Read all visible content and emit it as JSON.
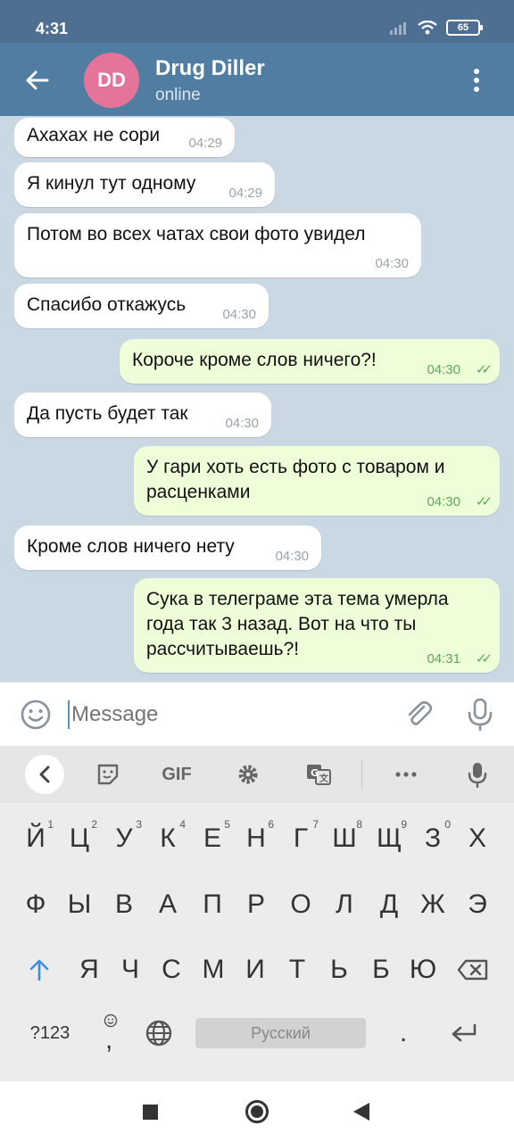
{
  "status_bar": {
    "time": "4:31",
    "battery": "65"
  },
  "header": {
    "avatar_initials": "DD",
    "name": "Drug Diller",
    "status": "online"
  },
  "messages": [
    {
      "text": "Ахахах не сори",
      "time": "04:29",
      "direction": "in"
    },
    {
      "text": "Я кинул тут одному",
      "time": "04:29",
      "direction": "in"
    },
    {
      "text": "Потом во всех чатах свои фото увидел",
      "time": "04:30",
      "direction": "in"
    },
    {
      "text": "Спасибо откажусь",
      "time": "04:30",
      "direction": "in"
    },
    {
      "text": "Короче кроме слов  ничего?!",
      "time": "04:30",
      "direction": "out",
      "read": true
    },
    {
      "text": "Да пусть будет так",
      "time": "04:30",
      "direction": "in"
    },
    {
      "text": "У гари хоть есть фото с товаром и расценками",
      "time": "04:30",
      "direction": "out",
      "read": true
    },
    {
      "text": "Кроме слов ничего нету",
      "time": "04:30",
      "direction": "in"
    },
    {
      "text": "Сука в телеграме эта тема умерла года так 3 назад.  Вот на что ты рассчитываешь?!",
      "time": "04:31",
      "direction": "out",
      "read": true
    }
  ],
  "composer": {
    "placeholder": "Message"
  },
  "keyboard": {
    "toolbar": {
      "gif_label": "GIF"
    },
    "row1": [
      {
        "key": "Й",
        "num": "1"
      },
      {
        "key": "Ц",
        "num": "2"
      },
      {
        "key": "У",
        "num": "3"
      },
      {
        "key": "К",
        "num": "4"
      },
      {
        "key": "Е",
        "num": "5"
      },
      {
        "key": "Н",
        "num": "6"
      },
      {
        "key": "Г",
        "num": "7"
      },
      {
        "key": "Ш",
        "num": "8"
      },
      {
        "key": "Щ",
        "num": "9"
      },
      {
        "key": "З",
        "num": "0"
      },
      {
        "key": "Х",
        "num": ""
      }
    ],
    "row2": [
      "Ф",
      "Ы",
      "В",
      "А",
      "П",
      "Р",
      "О",
      "Л",
      "Д",
      "Ж",
      "Э"
    ],
    "row3": [
      "Я",
      "Ч",
      "С",
      "М",
      "И",
      "Т",
      "Ь",
      "Б",
      "Ю"
    ],
    "row4": {
      "symbols_label": "?123",
      "comma": ",",
      "space_label": "Русский",
      "period": "."
    }
  },
  "colors": {
    "header": "#527da3",
    "status_bar": "#4e6f91",
    "avatar": "#e5749b",
    "outgoing_bubble": "#eefed9",
    "chat_background": "#c9d8e2"
  }
}
